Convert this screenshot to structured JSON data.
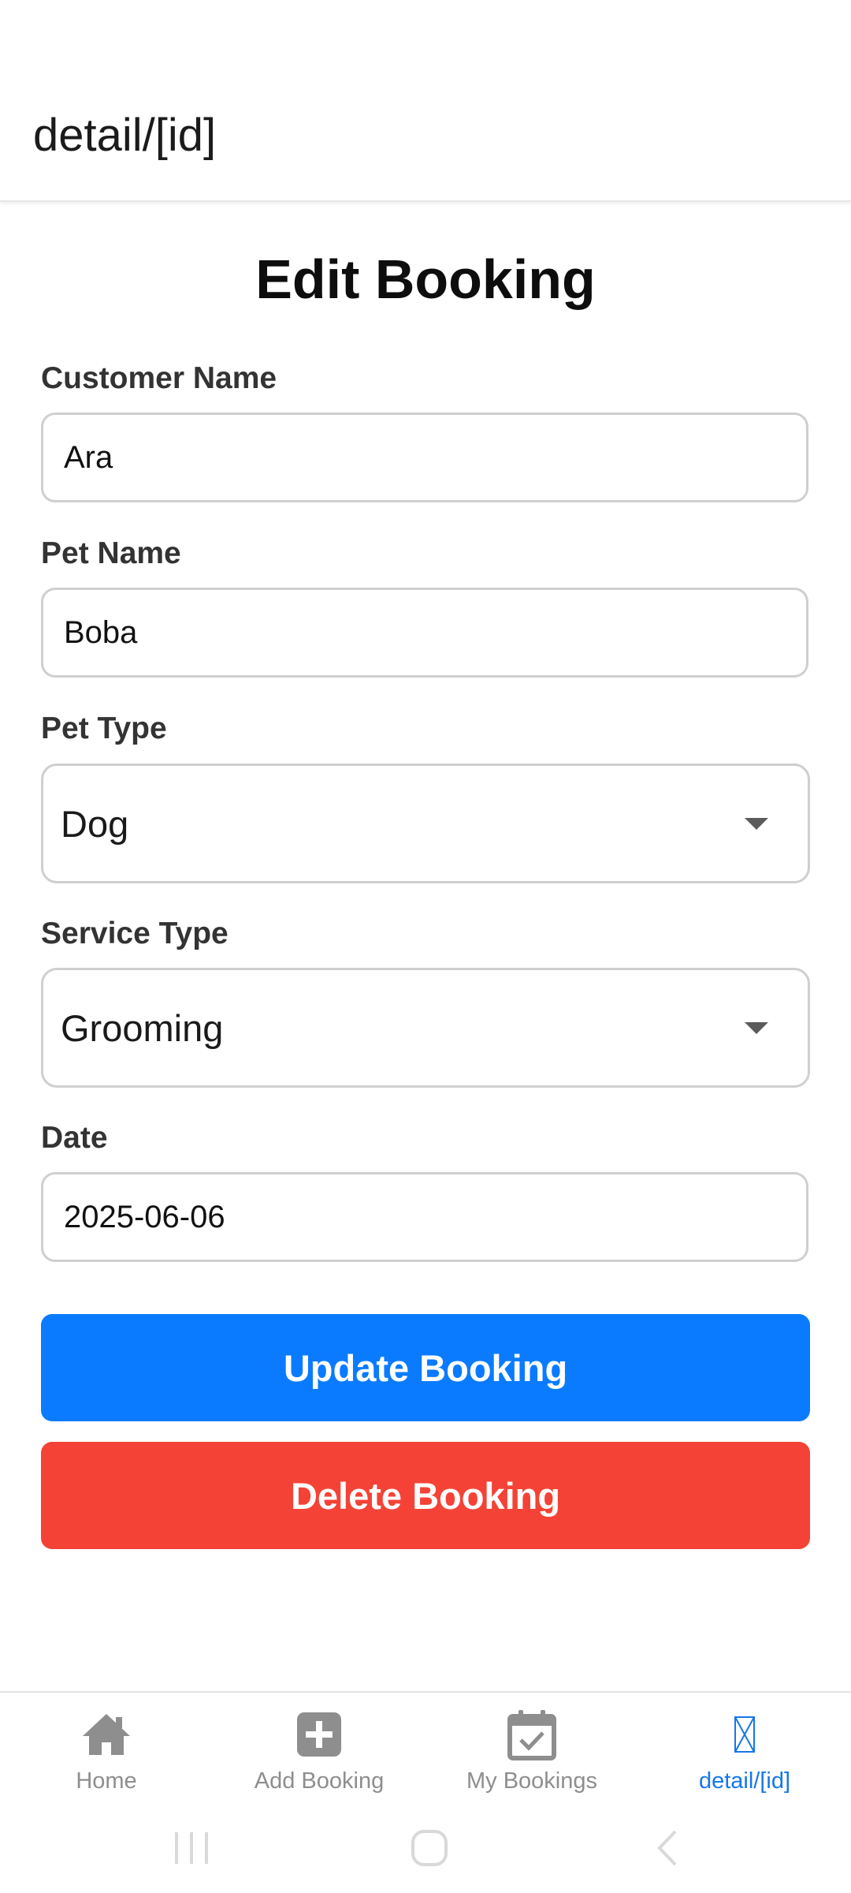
{
  "header": {
    "title": "detail/[id]"
  },
  "form": {
    "title": "Edit Booking",
    "customer_name": {
      "label": "Customer Name",
      "value": "Ara"
    },
    "pet_name": {
      "label": "Pet Name",
      "value": "Boba"
    },
    "pet_type": {
      "label": "Pet Type",
      "selected": "Dog"
    },
    "service_type": {
      "label": "Service Type",
      "selected": "Grooming"
    },
    "date": {
      "label": "Date",
      "value": "2025-06-06"
    },
    "update_label": "Update Booking",
    "delete_label": "Delete Booking"
  },
  "tabs": [
    {
      "label": "Home",
      "icon": "home-icon"
    },
    {
      "label": "Add Booking",
      "icon": "plus-square-icon"
    },
    {
      "label": "My Bookings",
      "icon": "calendar-check-icon"
    },
    {
      "label": "detail/[id]",
      "icon": "missing-glyph-icon"
    }
  ],
  "colors": {
    "primary": "#0a7bff",
    "danger": "#f44336",
    "tab_active": "#1677e8",
    "tab_inactive": "#8e8e8e"
  }
}
